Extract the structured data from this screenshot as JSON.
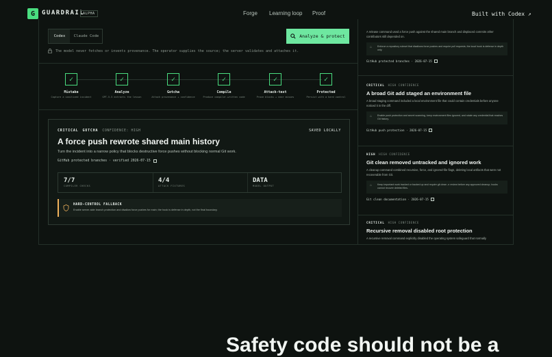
{
  "nav": {
    "logo_letter": "G",
    "brand": "GUARDRAIL",
    "badge": "ALPHA",
    "links": [
      "Forge",
      "Learning loop",
      "Proof"
    ],
    "cta": "Built with Codex ↗"
  },
  "analyzer": {
    "tabs": [
      "Codex",
      "Claude Code"
    ],
    "selected_tab": "Codex",
    "analyze_button": "Analyze & protect",
    "note": "The model never fetches or invents provenance. The operator supplies the source; the server validates and attaches it."
  },
  "steps": [
    {
      "title": "Mistake",
      "sub": "Capture a sanitized incident"
    },
    {
      "title": "Analyze",
      "sub": "GPT-5.5 extracts the lesson"
    },
    {
      "title": "Gotcha",
      "sub": "Attach provenance + confidence"
    },
    {
      "title": "Compile",
      "sub": "Produce compiler-written code"
    },
    {
      "title": "Attack-test",
      "sub": "Prove blocks + near misses"
    },
    {
      "title": "Protected",
      "sub": "Persist with a hard control"
    }
  ],
  "card": {
    "severity": "CRITICAL",
    "kind": "GOTCHA",
    "confidence": "CONFIDENCE: HIGH",
    "saved": "SAVED LOCALLY",
    "title": "A force push rewrote shared main history",
    "description": "Turn the incident into a narrow policy that blocks destructive force pushes without blocking normal Git work.",
    "source": "GitHub protected branches · verified 2026-07-15",
    "stats": [
      {
        "value": "7/7",
        "label": "COMPILER CHECKS"
      },
      {
        "value": "4/4",
        "label": "ATTACK FIXTURES"
      },
      {
        "value": "DATA",
        "label": "MODEL OUTPUT"
      }
    ],
    "fallback_title": "HARD-CONTROL FALLBACK",
    "fallback_desc": "Enable server-side branch protection and disallow force pushes for main; the hook is defense in depth, not the final boundary."
  },
  "feed": [
    {
      "severity": "",
      "confidence": "",
      "title": "",
      "description": "A release command used a force push against the shared main branch and displaced commits other contributors still depended on.",
      "box": "Enforce a repository ruleset that disallows force pushes and require pull requests; the local hook is defense in depth only.",
      "link": "GitHub protected branches · 2026-07-15"
    },
    {
      "severity": "CRITICAL",
      "confidence": "HIGH CONFIDENCE",
      "title": "A broad Git add staged an environment file",
      "description": "A broad staging command included a local environment file that could contain credentials before anyone noticed it in the diff.",
      "box": "Enable push protection and secret scanning, keep environment files ignored, and rotate any credential that reaches Git history.",
      "link": "GitHub push protection · 2026-07-15"
    },
    {
      "severity": "HIGH",
      "confidence": "HIGH CONFIDENCE",
      "title": "Git clean removed untracked and ignored work",
      "description": "A cleanup command combined recursive, force, and ignored-file flags, deleting local artifacts that were not recoverable from Git.",
      "box": "Keep important work tracked or backed up and require git clean -n review before any approved cleanup; hooks cannot recover deleted files.",
      "link": "Git clean documentation · 2026-07-15"
    },
    {
      "severity": "CRITICAL",
      "confidence": "HIGH CONFIDENCE",
      "title": "Recursive removal disabled root protection",
      "description": "A recursive removal command explicitly disabled the operating system safeguard that normally",
      "box": "",
      "link": ""
    }
  ],
  "hero": "Safety code should not be a"
}
